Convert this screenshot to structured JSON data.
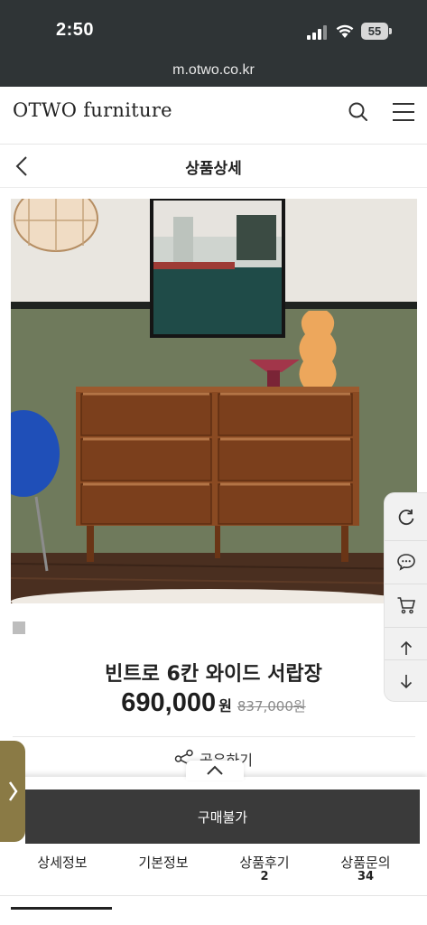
{
  "status_bar": {
    "time": "2:50",
    "battery": "55"
  },
  "browser": {
    "url": "m.otwo.co.kr"
  },
  "header": {
    "logo": "OTWO furniture"
  },
  "subheader": {
    "title": "상품상세"
  },
  "product": {
    "name": "빈트로 6칸 와이드 서랍장",
    "price": "690,000",
    "price_unit": "원",
    "original_price": "837,000원",
    "share_label": "공유하기"
  },
  "actions": {
    "buy_label": "구매불가"
  },
  "tabs": [
    {
      "label": "상세정보",
      "count": ""
    },
    {
      "label": "기본정보",
      "count": ""
    },
    {
      "label": "상품후기",
      "count": "2"
    },
    {
      "label": "상품문의",
      "count": "34"
    }
  ],
  "colors": {
    "status_bar_bg": "#2f3436",
    "buy_bar_bg": "#3a3a3a",
    "side_tab_bg": "#8a7a45",
    "dresser": "#8a4a22",
    "wall_green": "#6f7a5c"
  },
  "icons": {
    "header": [
      "search-icon",
      "hamburger-menu-icon"
    ],
    "toolbar": [
      "refresh-icon",
      "chat-icon",
      "cart-icon",
      "arrow-up-icon",
      "arrow-down-icon"
    ],
    "share": "share-icon",
    "back": "chevron-left-icon",
    "sheet_handle": "chevron-up-icon",
    "side_tab": "chevron-right-icon"
  }
}
